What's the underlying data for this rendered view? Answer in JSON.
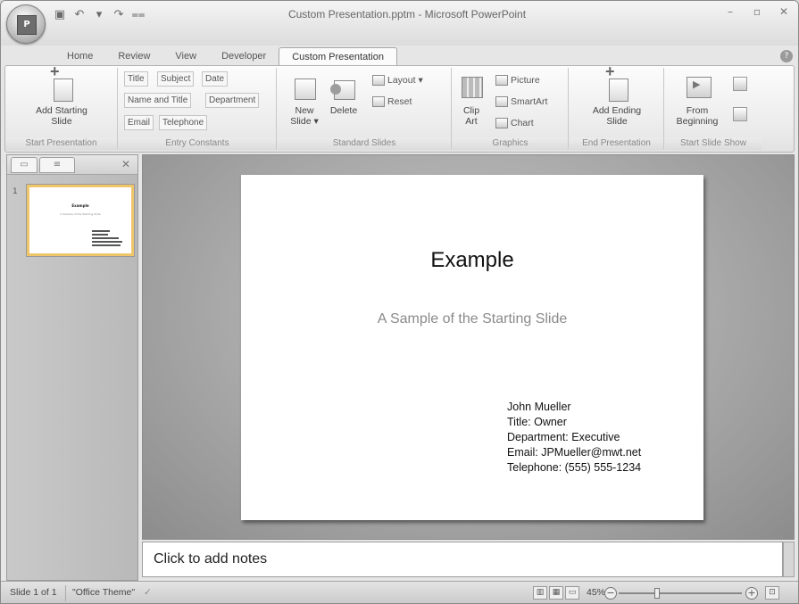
{
  "title_bar": {
    "title": "Custom Presentation.pptm - Microsoft PowerPoint",
    "office_logo": "logo",
    "qat": [
      "save-icon",
      "undo-icon",
      "redo-icon",
      "customize-icon"
    ]
  },
  "tabs": [
    {
      "label": "Home"
    },
    {
      "label": "Review"
    },
    {
      "label": "View"
    },
    {
      "label": "Developer"
    },
    {
      "label": "Custom Presentation",
      "active": true
    }
  ],
  "ribbon": {
    "start_presentation": {
      "add_starting_slide_line1": "Add Starting",
      "add_starting_slide_line2": "Slide",
      "group_label": "Start Presentation"
    },
    "entry_constants": {
      "title": "Title",
      "subject": "Subject",
      "date": "Date",
      "name_and_title": "Name and Title",
      "department": "Department",
      "email": "Email",
      "telephone": "Telephone",
      "group_label": "Entry Constants"
    },
    "standard_slides": {
      "new_slide_line1": "New",
      "new_slide_line2": "Slide ▾",
      "delete": "Delete",
      "layout": "Layout ▾",
      "reset": "Reset",
      "group_label": "Standard Slides"
    },
    "graphics": {
      "clip_art_line1": "Clip",
      "clip_art_line2": "Art",
      "picture": "Picture",
      "smartart": "SmartArt",
      "chart": "Chart",
      "group_label": "Graphics"
    },
    "end_presentation": {
      "add_ending_slide_line1": "Add Ending",
      "add_ending_slide_line2": "Slide",
      "group_label": "End Presentation"
    },
    "start_slide_show": {
      "from_beginning_line1": "From",
      "from_beginning_line2": "Beginning",
      "group_label": "Start Slide Show"
    }
  },
  "slides_pane": {
    "thumb_number": "1",
    "thumb_title": "Example",
    "thumb_subtitle": "A Sample of the Starting Slide"
  },
  "slide": {
    "title": "Example",
    "subtitle": "A Sample of the Starting Slide",
    "info": [
      "John Mueller",
      "Title: Owner",
      "Department: Executive",
      "Email: JPMueller@mwt.net",
      "Telephone: (555) 555-1234"
    ]
  },
  "notes": {
    "placeholder": "Click to add notes"
  },
  "status_bar": {
    "slide_count": "Slide 1 of 1",
    "theme": "\"Office Theme\"",
    "zoom": "45%",
    "zoom_level": 0.45
  }
}
